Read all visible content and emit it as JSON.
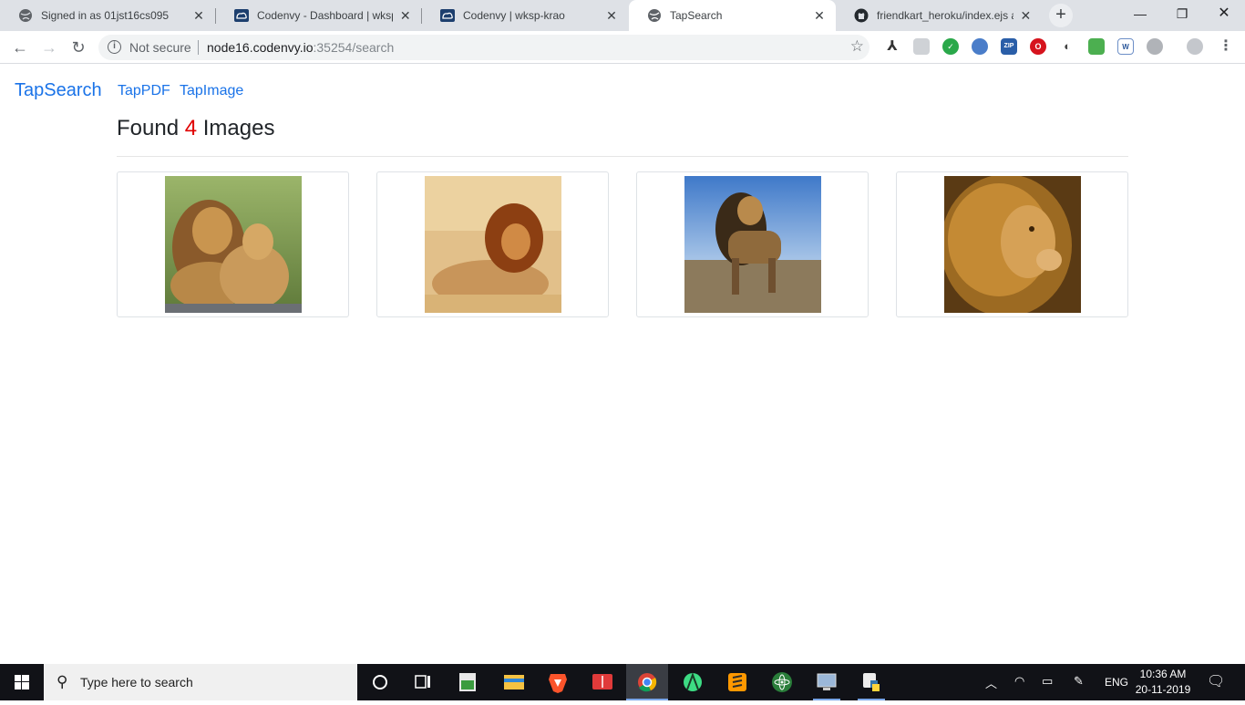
{
  "browser": {
    "tabs": [
      {
        "title": "Signed in as 01jst16cs095",
        "favicon": "globe-icon",
        "active": false
      },
      {
        "title": "Codenvy - Dashboard | wksp-k",
        "favicon": "codenvy-icon",
        "active": false
      },
      {
        "title": "Codenvy | wksp-krao",
        "favicon": "codenvy-icon",
        "active": false
      },
      {
        "title": "TapSearch",
        "favicon": "globe-icon",
        "active": true
      },
      {
        "title": "friendkart_heroku/index.ejs at",
        "favicon": "github-icon",
        "active": false
      }
    ],
    "security_label": "Not secure",
    "url_host": "node16.codenvy.io",
    "url_path": ":35254/search"
  },
  "page": {
    "brand": "TapSearch",
    "nav": [
      "TapPDF",
      "TapImage"
    ],
    "heading_prefix": "Found",
    "result_count": "4",
    "heading_suffix": "Images",
    "count_color": "#e00000",
    "link_color": "#1a73e8",
    "results": [
      {
        "subject": "lion and lioness resting together"
      },
      {
        "subject": "male lion lying in dry grass"
      },
      {
        "subject": "lion standing on savanna"
      },
      {
        "subject": "lion head in profile"
      }
    ]
  },
  "taskbar": {
    "search_placeholder": "Type here to search",
    "language": "ENG",
    "time": "10:36 AM",
    "date": "20-11-2019"
  }
}
